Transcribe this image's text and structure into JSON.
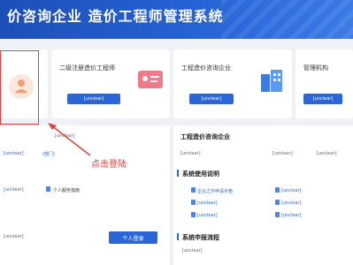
{
  "header": {
    "title": "价咨询企业   造价工程师管理系统"
  },
  "cards": {
    "engineer_title": "二级注册造价工程师",
    "engineer_login": "[unclear]",
    "enterprise_title": "工程造价咨询企业",
    "enterprise_login": "[unclear]",
    "management_title": "管理机构",
    "management_login": "[unclear]"
  },
  "left_panel": {
    "hotline": "[unclear]",
    "col_a": "[unclear]",
    "col_b": "(部门)",
    "link_1": "[unclear]",
    "link_2": "个人服务指南",
    "note": "[unclear]",
    "login_button": "个人登录"
  },
  "annotation": {
    "text": "点击登陆"
  },
  "right_panel": {
    "title": "工程造价咨询企业",
    "sub_1": "[unclear]",
    "sub_2": "[unclear]",
    "sub_3": "[unclear]",
    "manual_title": "系统使用说明",
    "manual_items": [
      "企业之外申请手册",
      "[unclear]",
      "[unclear]",
      "[unclear]",
      "[unclear]",
      "[unclear]"
    ],
    "process_title": "系统申报流程",
    "process_line": "[unclear]"
  },
  "colors": {
    "header_blue": "#2563d6",
    "button_blue": "#2b66d9",
    "annotation_red": "#e8413a",
    "avatar_orange": "#f0a070",
    "card_icon_pink": "#f07a8a"
  }
}
